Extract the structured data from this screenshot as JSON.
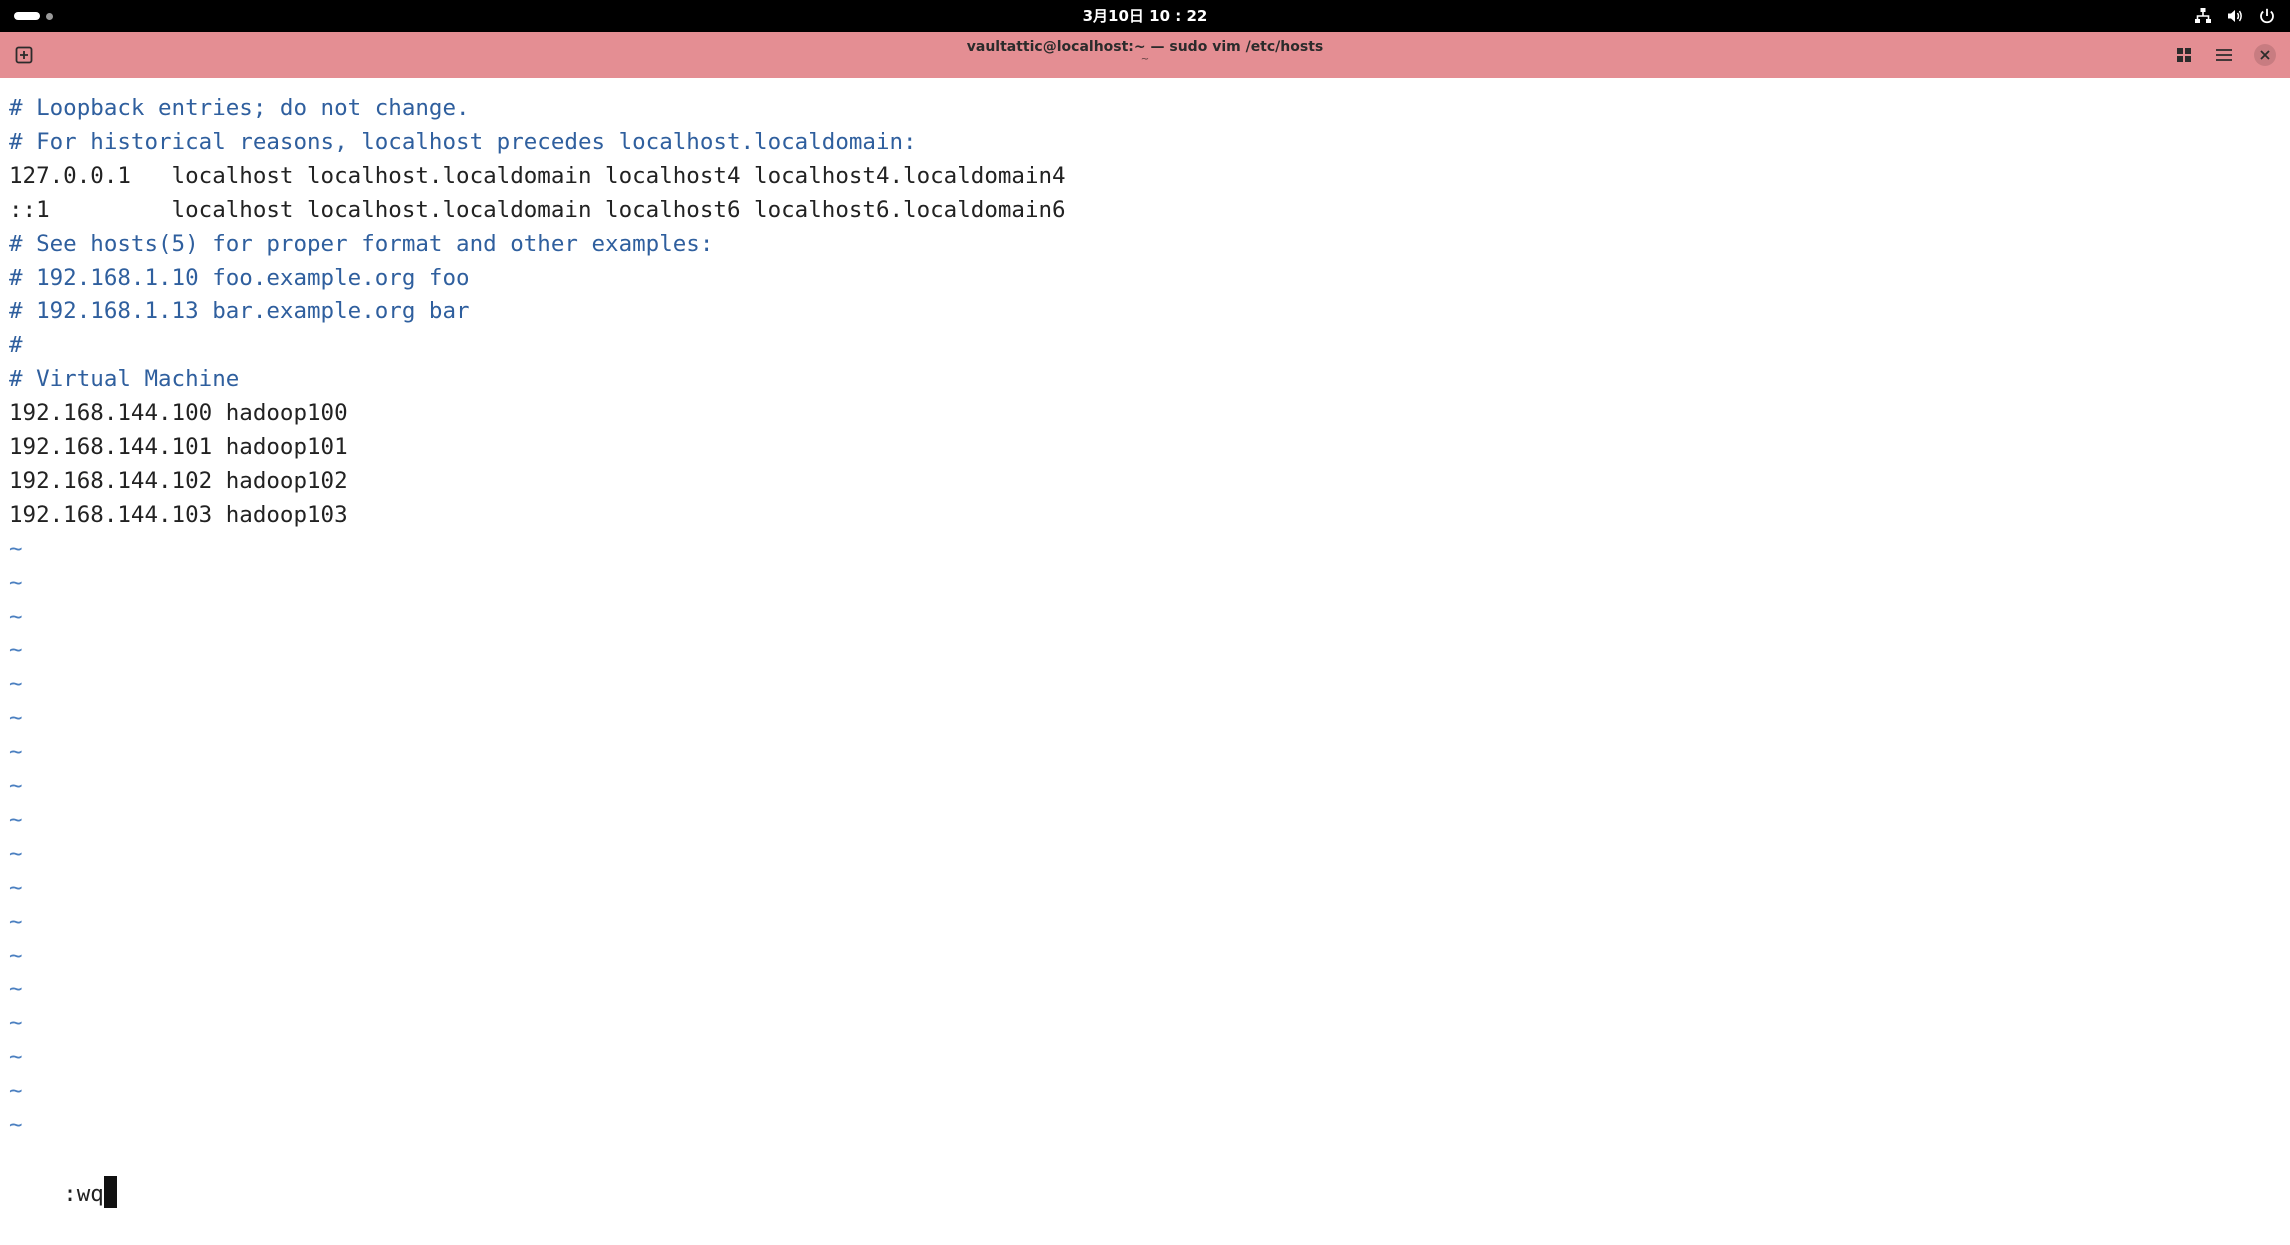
{
  "topbar": {
    "clock": "3月10日 10 : 22",
    "icons": [
      "activities-indicator",
      "network-icon",
      "volume-icon",
      "power-icon"
    ]
  },
  "window": {
    "title": "vaultattic@localhost:~ — sudo vim /etc/hosts",
    "subtitle_mark": "~",
    "titlebar_color": "#e48e93",
    "icons": [
      "new-tab-icon",
      "grid-view-icon",
      "menu-icon",
      "close-icon"
    ]
  },
  "editor": {
    "lines": [
      {
        "text": "# Loopback entries; do not change.",
        "kind": "comment"
      },
      {
        "text": "# For historical reasons, localhost precedes localhost.localdomain:",
        "kind": "comment"
      },
      {
        "text": "127.0.0.1   localhost localhost.localdomain localhost4 localhost4.localdomain4",
        "kind": "normal"
      },
      {
        "text": "::1         localhost localhost.localdomain localhost6 localhost6.localdomain6",
        "kind": "normal"
      },
      {
        "text": "# See hosts(5) for proper format and other examples:",
        "kind": "comment"
      },
      {
        "text": "# 192.168.1.10 foo.example.org foo",
        "kind": "comment"
      },
      {
        "text": "# 192.168.1.13 bar.example.org bar",
        "kind": "comment"
      },
      {
        "text": "#",
        "kind": "comment"
      },
      {
        "text": "# Virtual Machine",
        "kind": "comment"
      },
      {
        "text": "192.168.144.100 hadoop100",
        "kind": "normal"
      },
      {
        "text": "192.168.144.101 hadoop101",
        "kind": "normal"
      },
      {
        "text": "192.168.144.102 hadoop102",
        "kind": "normal"
      },
      {
        "text": "192.168.144.103 hadoop103",
        "kind": "normal"
      },
      {
        "text": "~",
        "kind": "tilde"
      },
      {
        "text": "~",
        "kind": "tilde"
      },
      {
        "text": "~",
        "kind": "tilde"
      },
      {
        "text": "~",
        "kind": "tilde"
      },
      {
        "text": "~",
        "kind": "tilde"
      },
      {
        "text": "~",
        "kind": "tilde"
      },
      {
        "text": "~",
        "kind": "tilde"
      },
      {
        "text": "~",
        "kind": "tilde"
      },
      {
        "text": "~",
        "kind": "tilde"
      },
      {
        "text": "~",
        "kind": "tilde"
      },
      {
        "text": "~",
        "kind": "tilde"
      },
      {
        "text": "~",
        "kind": "tilde"
      },
      {
        "text": "~",
        "kind": "tilde"
      },
      {
        "text": "~",
        "kind": "tilde"
      },
      {
        "text": "~",
        "kind": "tilde"
      },
      {
        "text": "~",
        "kind": "tilde"
      },
      {
        "text": "~",
        "kind": "tilde"
      },
      {
        "text": "~",
        "kind": "tilde"
      }
    ],
    "command_line": ":wq",
    "colors": {
      "comment": "#2f5f9e",
      "tilde": "#4a7fc0",
      "normal": "#222222"
    }
  }
}
